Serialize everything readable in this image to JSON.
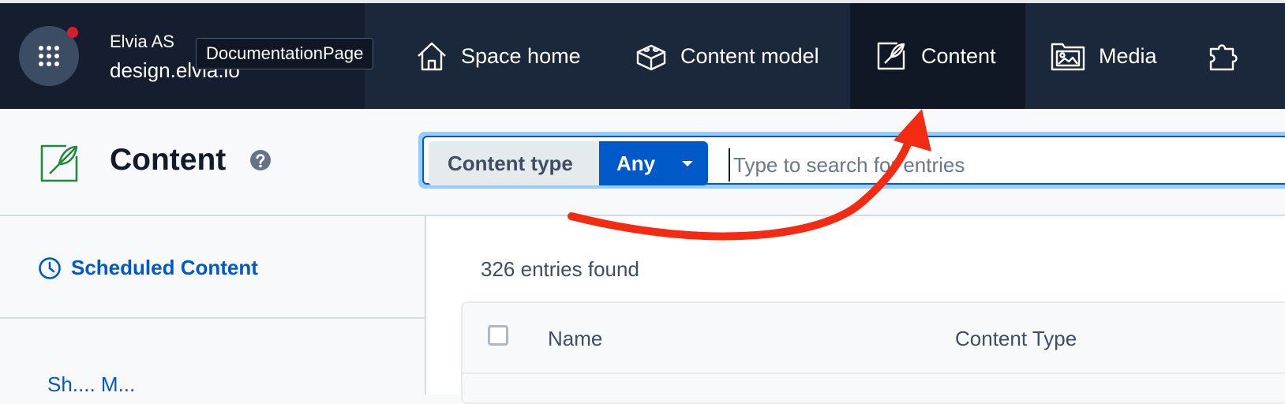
{
  "space": {
    "org_name": "Elvia AS",
    "space_name": "design.elvia.io",
    "tooltip": "DocumentationPage"
  },
  "nav": {
    "items": [
      {
        "label": "Space home",
        "icon": "house-icon"
      },
      {
        "label": "Content model",
        "icon": "blocks-icon"
      },
      {
        "label": "Content",
        "icon": "feather-icon",
        "active": true
      },
      {
        "label": "Media",
        "icon": "image-folder-icon"
      }
    ]
  },
  "header": {
    "title": "Content",
    "help_icon": "question-icon"
  },
  "search": {
    "content_type_label": "Content type",
    "content_type_value": "Any",
    "placeholder": "Type to search for entries"
  },
  "sidebar": {
    "scheduled_label": "Scheduled Content",
    "cut_text": "Sh....   M..."
  },
  "main": {
    "entries_found": "326 entries found",
    "columns": [
      "Name",
      "Content Type"
    ]
  },
  "colors": {
    "topbar": "#1b273a",
    "accent": "#0059c8",
    "annotation_arrow": "#f22b12"
  }
}
